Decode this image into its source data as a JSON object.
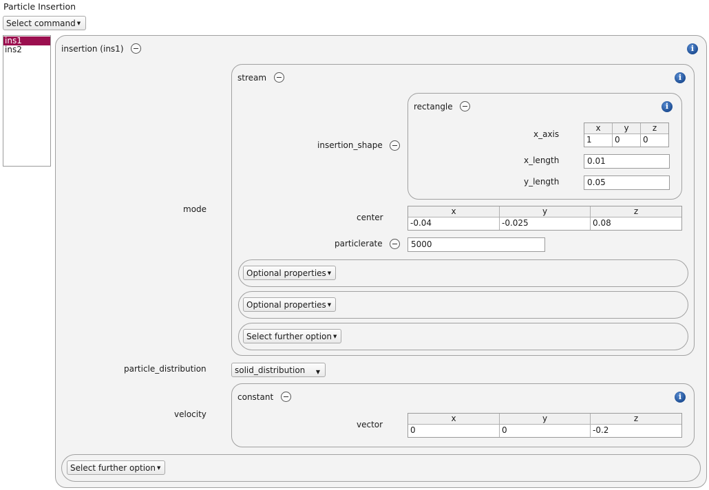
{
  "page": {
    "title": "Particle Insertion"
  },
  "toolbar": {
    "select_command": "Select command"
  },
  "list": {
    "items": [
      {
        "label": "ins1",
        "selected": true
      },
      {
        "label": "ins2",
        "selected": false
      }
    ]
  },
  "insertion": {
    "title": "insertion (ins1)",
    "mode_label": "mode",
    "stream": {
      "title": "stream",
      "insertion_shape_label": "insertion_shape",
      "rectangle": {
        "title": "rectangle",
        "x_axis_label": "x_axis",
        "x_axis": {
          "headers": [
            "x",
            "y",
            "z"
          ],
          "values": [
            "1",
            "0",
            "0"
          ]
        },
        "x_length_label": "x_length",
        "x_length": "0.01",
        "y_length_label": "y_length",
        "y_length": "0.05"
      },
      "center_label": "center",
      "center": {
        "headers": [
          "x",
          "y",
          "z"
        ],
        "values": [
          "-0.04",
          "-0.025",
          "0.08"
        ]
      },
      "particlerate_label": "particlerate",
      "particlerate": "5000",
      "optional_properties_1": "Optional properties",
      "optional_properties_2": "Optional properties",
      "select_further_option": "Select further option"
    },
    "particle_distribution_label": "particle_distribution",
    "particle_distribution_value": "solid_distribution",
    "velocity_label": "velocity",
    "velocity": {
      "title": "constant",
      "vector_label": "vector",
      "vector": {
        "headers": [
          "x",
          "y",
          "z"
        ],
        "values": [
          "0",
          "0",
          "-0.2"
        ]
      }
    },
    "select_further_option": "Select further option"
  },
  "colors": {
    "selection": "#9b0f4f",
    "info_icon": "#1d4d93",
    "group_bg": "#f3f3f3"
  }
}
